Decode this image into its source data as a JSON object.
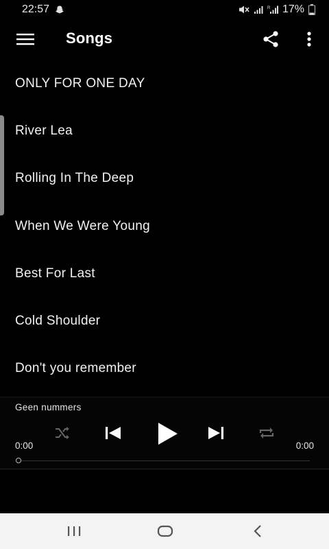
{
  "status_bar": {
    "time": "22:57",
    "battery_text": "17%",
    "icons": [
      "snapchat-ghost-icon",
      "mute-icon",
      "signal-icon",
      "signal-r-icon",
      "battery-icon"
    ]
  },
  "app_bar": {
    "title": "Songs",
    "icons": [
      "hamburger-menu-icon",
      "share-icon",
      "more-vert-icon"
    ]
  },
  "songs": [
    "ONLY FOR ONE DAY",
    "River Lea",
    "Rolling In The Deep",
    "When We Were Young",
    "Best For Last",
    "Cold Shoulder",
    "Don't you remember"
  ],
  "player": {
    "now_playing": "Geen nummers",
    "time_elapsed": "0:00",
    "time_total": "0:00",
    "progress": 0,
    "icons": [
      "shuffle-icon",
      "skip-previous-icon",
      "play-icon",
      "skip-next-icon",
      "repeat-icon"
    ]
  },
  "nav_bar": {
    "icons": [
      "recents-icon",
      "home-icon",
      "back-icon"
    ]
  },
  "colors": {
    "background": "#000000",
    "text": "#ffffff",
    "nav_bar_bg": "#f3f3f3",
    "disabled_icon": "#666666"
  }
}
